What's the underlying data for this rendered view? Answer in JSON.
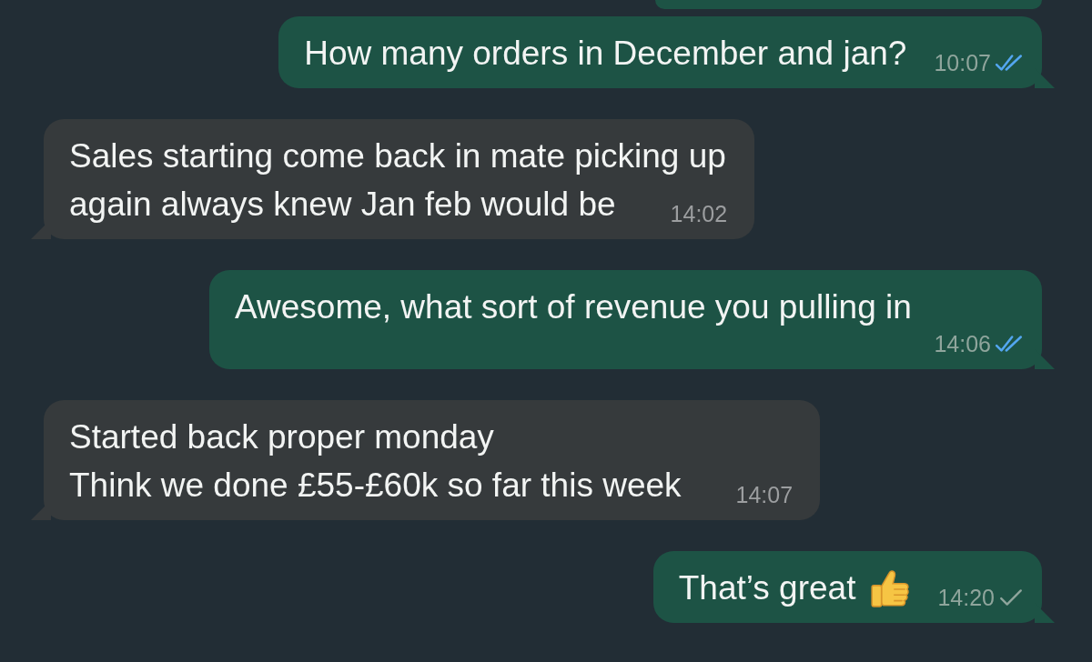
{
  "messages": [
    {
      "kind": "outgoing",
      "lines": [
        "How many orders in December and jan?"
      ],
      "time": "10:07",
      "read": true,
      "thumbs_up": false
    },
    {
      "kind": "incoming",
      "lines": [
        "Sales starting come back in mate picking up",
        "again always knew Jan feb would be"
      ],
      "time": "14:02",
      "thumbs_up": false
    },
    {
      "kind": "outgoing",
      "lines": [
        "Awesome, what sort of revenue you pulling in"
      ],
      "time": "14:06",
      "read": true,
      "thumbs_up": false
    },
    {
      "kind": "incoming",
      "lines": [
        "Started back proper monday",
        "Think we done £55-£60k so far this week"
      ],
      "time": "14:07",
      "thumbs_up": false
    },
    {
      "kind": "outgoing",
      "lines": [
        "That’s great"
      ],
      "time": "14:20",
      "read": false,
      "thumbs_up": true
    }
  ]
}
